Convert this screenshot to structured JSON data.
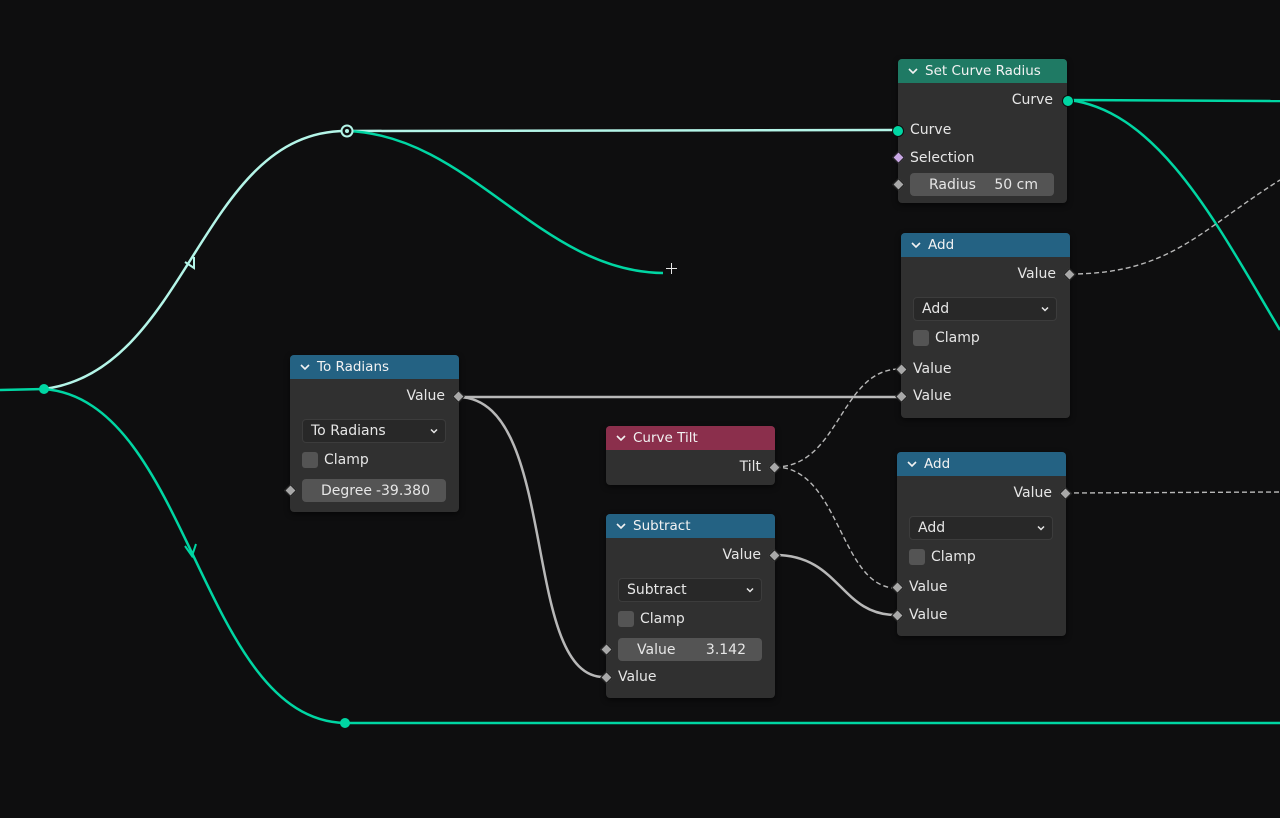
{
  "colors": {
    "background": "#0e0e0f",
    "node_body": "#303030",
    "header_input": "#246283",
    "header_geometry": "#1f7a64",
    "header_curve": "#8b2f4c",
    "geometry_link": "#00d6a3",
    "geometry_link_selected": "#b4f5e8",
    "float_link": "#b8b8b8"
  },
  "nodes": {
    "set_curve_radius": {
      "title": "Set Curve Radius",
      "output_curve": "Curve",
      "input_curve": "Curve",
      "input_selection": "Selection",
      "radius_label": "Radius",
      "radius_value": "50 cm"
    },
    "add_1": {
      "title": "Add",
      "output_value": "Value",
      "operation": "Add",
      "clamp_label": "Clamp",
      "input_a": "Value",
      "input_b": "Value"
    },
    "to_radians": {
      "title": "To Radians",
      "output_value": "Value",
      "operation": "To Radians",
      "clamp_label": "Clamp",
      "degree_label": "Degree",
      "degree_value": "-39.380"
    },
    "curve_tilt": {
      "title": "Curve Tilt",
      "output_tilt": "Tilt"
    },
    "add_2": {
      "title": "Add",
      "output_value": "Value",
      "operation": "Add",
      "clamp_label": "Clamp",
      "input_a": "Value",
      "input_b": "Value"
    },
    "subtract": {
      "title": "Subtract",
      "output_value": "Value",
      "operation": "Subtract",
      "clamp_label": "Clamp",
      "value_label": "Value",
      "value_value": "3.142",
      "input_b": "Value"
    }
  },
  "icons": {
    "collapse": "chevron-down-icon",
    "dropdown": "chevron-down-icon",
    "cursor": "crosshair-icon",
    "reroute_arrow": "arrow-icon"
  }
}
